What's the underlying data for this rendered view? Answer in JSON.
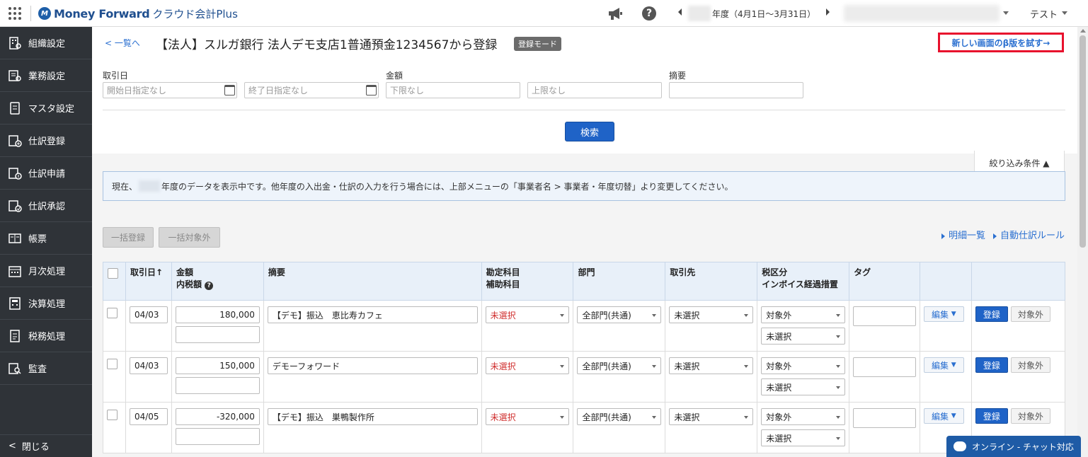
{
  "header": {
    "logo": "Money Forward",
    "product": "クラウド会計Plus",
    "year_text": "年度（4月1日〜3月31日）",
    "user": "テスト"
  },
  "sidebar": {
    "items": [
      {
        "label": "組織設定",
        "icon": "building-icon"
      },
      {
        "label": "業務設定",
        "icon": "settings-list-icon"
      },
      {
        "label": "マスタ設定",
        "icon": "master-icon"
      },
      {
        "label": "仕訳登録",
        "icon": "journal-add-icon"
      },
      {
        "label": "仕訳申請",
        "icon": "journal-request-icon"
      },
      {
        "label": "仕訳承認",
        "icon": "journal-approve-icon"
      },
      {
        "label": "帳票",
        "icon": "book-icon"
      },
      {
        "label": "月次処理",
        "icon": "calendar-icon"
      },
      {
        "label": "決算処理",
        "icon": "calculator-icon"
      },
      {
        "label": "税務処理",
        "icon": "tax-doc-icon"
      },
      {
        "label": "監査",
        "icon": "audit-icon"
      }
    ],
    "close_label": "閉じる"
  },
  "page": {
    "back_label": "一覧へ",
    "title": "【法人】スルガ銀行 法人デモ支店1普通預金1234567から登録",
    "mode_badge": "登録モード",
    "beta_label": "新しい画面のβ版を試す→"
  },
  "filters": {
    "date_label": "取引日",
    "date_start_placeholder": "開始日指定なし",
    "date_end_placeholder": "終了日指定なし",
    "amount_label": "金額",
    "amount_min_placeholder": "下限なし",
    "amount_max_placeholder": "上限なし",
    "summary_label": "摘要",
    "search_label": "検索",
    "filter_toggle": "絞り込み条件 ▲"
  },
  "notice": {
    "prefix": "現在、",
    "text": "年度のデータを表示中です。他年度の入出金・仕訳の入力を行う場合には、上部メニューの「事業者名 > 事業者・年度切替」より変更してください。"
  },
  "actions": {
    "bulk_register": "一括登録",
    "bulk_exclude": "一括対象外",
    "detail_list": "明細一覧",
    "auto_rule": "自動仕訳ルール"
  },
  "table": {
    "headers": {
      "date": "取引日↑",
      "amount": "金額",
      "tax_included": "内税額",
      "summary": "摘要",
      "account": "勘定科目",
      "sub_account": "補助科目",
      "department": "部門",
      "partner": "取引先",
      "tax_class": "税区分",
      "invoice": "インボイス経過措置",
      "tag": "タグ"
    },
    "rows": [
      {
        "date": "04/03",
        "amount": "180,000",
        "summary": "【デモ】振込　恵比寿カフェ",
        "account": "未選択",
        "department": "全部門(共通)",
        "partner": "未選択",
        "tax": "対象外",
        "invoice": "未選択",
        "edit": "編集",
        "register": "登録",
        "exclude": "対象外"
      },
      {
        "date": "04/03",
        "amount": "150,000",
        "summary": "デモーフォワード",
        "account": "未選択",
        "department": "全部門(共通)",
        "partner": "未選択",
        "tax": "対象外",
        "invoice": "未選択",
        "edit": "編集",
        "register": "登録",
        "exclude": "対象外"
      },
      {
        "date": "04/05",
        "amount": "-320,000",
        "summary": "【デモ】振込　巣鴨製作所",
        "account": "未選択",
        "department": "全部門(共通)",
        "partner": "未選択",
        "tax": "対象外",
        "invoice": "未選択",
        "edit": "編集",
        "register": "登録",
        "exclude": "対象外"
      }
    ]
  },
  "chat": {
    "label": "オンライン - チャット対応"
  }
}
